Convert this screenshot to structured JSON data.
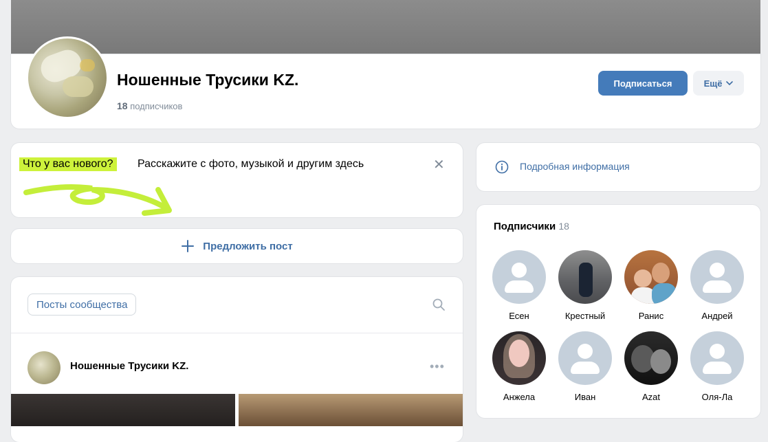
{
  "group": {
    "name": "Ношенные Трусики KZ.",
    "subscribers_count": "18",
    "subscribers_label": "подписчиков",
    "subscribe_button": "Подписаться",
    "more_button": "Ещё"
  },
  "new_post": {
    "highlight": "Что у вас нового?",
    "prompt": "Расскажите с фото, музыкой и другим здесь",
    "close": "✕"
  },
  "suggest": {
    "label": "Предложить пост"
  },
  "posts": {
    "tab_label": "Посты сообщества",
    "author": "Ношенные Трусики KZ.",
    "menu": "•••"
  },
  "info": {
    "label": "Подробная информация"
  },
  "followers": {
    "title": "Подписчики",
    "count": "18",
    "items": [
      {
        "name": "Есен"
      },
      {
        "name": "Крестный"
      },
      {
        "name": "Ранис"
      },
      {
        "name": "Андрей"
      },
      {
        "name": "Анжела"
      },
      {
        "name": "Иван"
      },
      {
        "name": "Azat"
      },
      {
        "name": "Оля-Ла"
      }
    ]
  },
  "colors": {
    "accent": "#447bba",
    "link": "#3f6ea5",
    "highlight": "#cdf23b",
    "background": "#edeef0"
  }
}
